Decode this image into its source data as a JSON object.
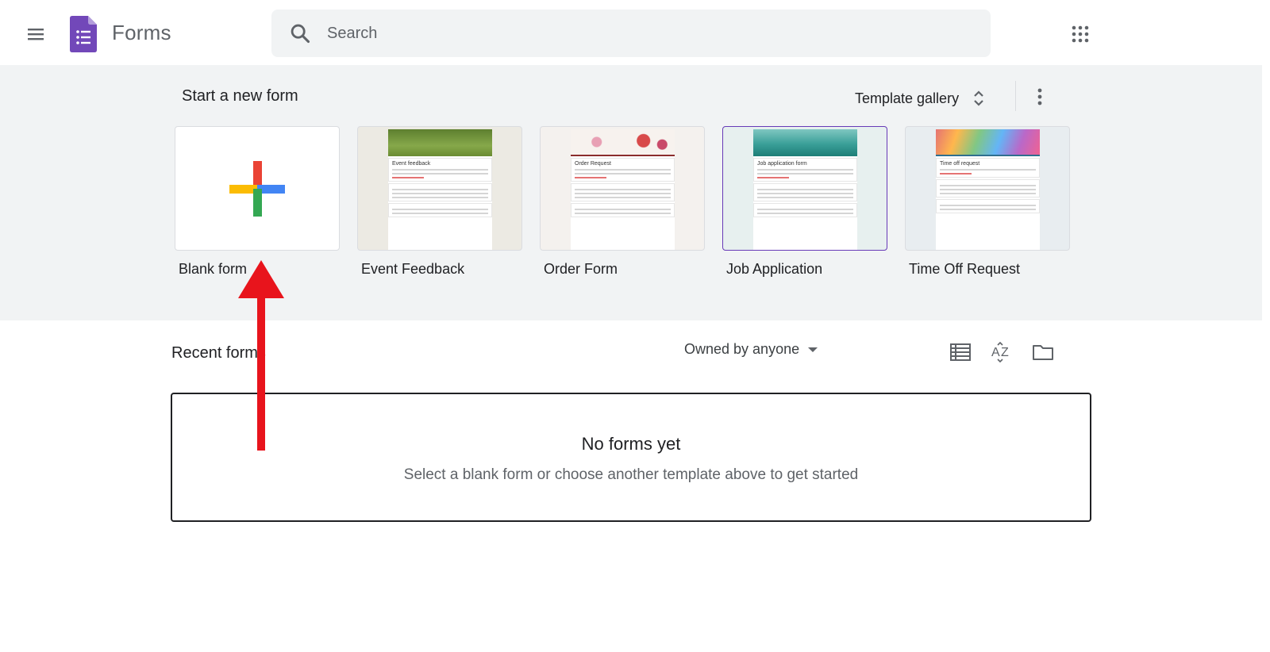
{
  "header": {
    "app_name": "Forms",
    "search_placeholder": "Search",
    "menu_icon": "hamburger-menu-icon",
    "apps_icon": "apps-grid-icon"
  },
  "templates": {
    "title": "Start a new form",
    "gallery_label": "Template gallery",
    "items": [
      {
        "label": "Blank form",
        "thumb_title": ""
      },
      {
        "label": "Event Feedback",
        "thumb_title": "Event feedback"
      },
      {
        "label": "Order Form",
        "thumb_title": "Order Request"
      },
      {
        "label": "Job Application",
        "thumb_title": "Job application form"
      },
      {
        "label": "Time Off Request",
        "thumb_title": "Time off request"
      }
    ]
  },
  "recent": {
    "title": "Recent forms",
    "owner_filter": "Owned by anyone",
    "empty_title": "No forms yet",
    "empty_subtitle": "Select a blank form or choose another template above to get started"
  },
  "colors": {
    "brand_purple": "#673ab7",
    "annotation_red": "#e8141c",
    "band_bg": "#f1f3f4"
  }
}
